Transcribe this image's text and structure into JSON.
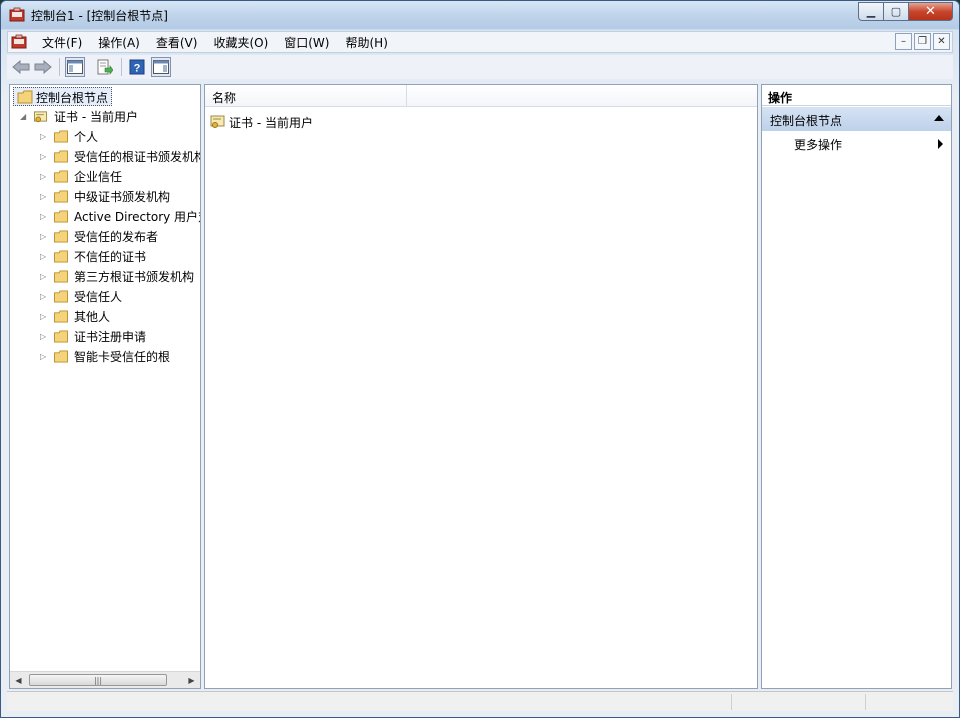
{
  "window": {
    "title": "控制台1 - [控制台根节点]"
  },
  "menubar": {
    "items": [
      "文件(F)",
      "操作(A)",
      "查看(V)",
      "收藏夹(O)",
      "窗口(W)",
      "帮助(H)"
    ]
  },
  "toolbar": {
    "icons": [
      "back-icon",
      "forward-icon",
      "show-hide-console-tree-icon",
      "export-list-icon",
      "help-icon",
      "show-hide-action-pane-icon"
    ]
  },
  "tree": {
    "root": "控制台根节点",
    "child": "证书 - 当前用户",
    "stores": [
      "个人",
      "受信任的根证书颁发机构",
      "企业信任",
      "中级证书颁发机构",
      "Active Directory 用户对象",
      "受信任的发布者",
      "不信任的证书",
      "第三方根证书颁发机构",
      "受信任人",
      "其他人",
      "证书注册申请",
      "智能卡受信任的根"
    ]
  },
  "list": {
    "column_name": "名称",
    "rows": [
      "证书 - 当前用户"
    ]
  },
  "actions": {
    "header": "操作",
    "section": "控制台根节点",
    "more": "更多操作"
  },
  "colors": {
    "accent": "#bdd1ea",
    "folder": "#f2c94c"
  }
}
